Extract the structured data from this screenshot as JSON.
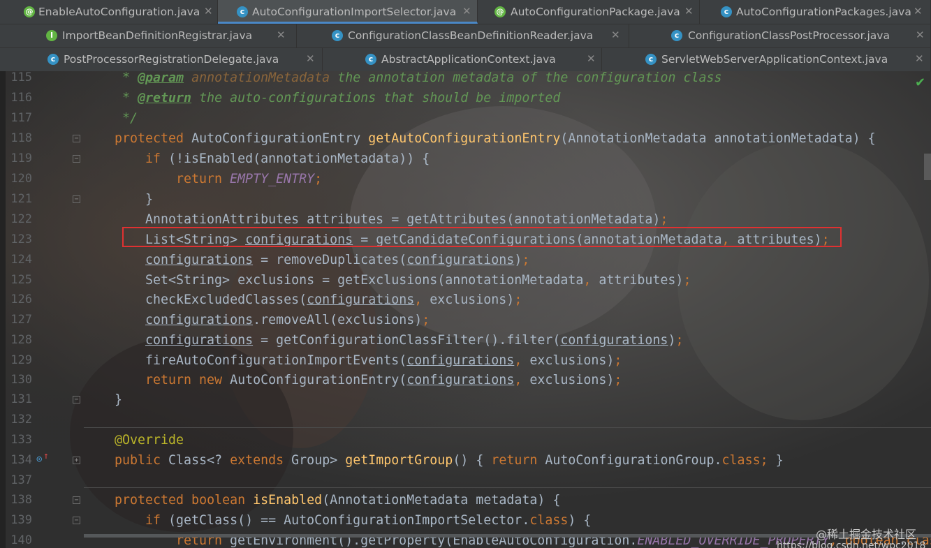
{
  "tabs": {
    "row1": [
      {
        "icon": "annotation-icon",
        "label": "EnableAutoConfiguration.java"
      },
      {
        "icon": "class-icon",
        "label": "AutoConfigurationImportSelector.java",
        "active": true
      },
      {
        "icon": "annotation-icon",
        "label": "AutoConfigurationPackage.java"
      },
      {
        "icon": "class-icon",
        "label": "AutoConfigurationPackages.java"
      }
    ],
    "row2": [
      {
        "icon": "interface-icon",
        "label": "ImportBeanDefinitionRegistrar.java"
      },
      {
        "icon": "class-icon",
        "label": "ConfigurationClassBeanDefinitionReader.java"
      },
      {
        "icon": "class-icon",
        "label": "ConfigurationClassPostProcessor.java"
      }
    ],
    "row3": [
      {
        "icon": "class-icon",
        "label": "PostProcessorRegistrationDelegate.java"
      },
      {
        "icon": "class-icon",
        "label": "AbstractApplicationContext.java"
      },
      {
        "icon": "class-icon",
        "label": "ServletWebServerApplicationContext.java"
      }
    ]
  },
  "editor": {
    "line_numbers": [
      "115",
      "116",
      "117",
      "118",
      "119",
      "120",
      "121",
      "122",
      "123",
      "124",
      "125",
      "126",
      "127",
      "128",
      "129",
      "130",
      "131",
      "132",
      "133",
      "134",
      "137",
      "138",
      "139",
      "140"
    ],
    "highlighted_line": "123",
    "status_icon": "inspection-ok-icon",
    "watermark": [
      "@稀土掘金技术社区",
      "https://blog.csdn.net/wpc2018"
    ]
  },
  "colors": {
    "background": "#2b2b2b",
    "keyword": "#cc7832",
    "method": "#ffc66d",
    "text": "#a9b7c6",
    "javadoc": "#629755",
    "constant": "#9876aa",
    "annotation": "#bbb529",
    "highlight_border": "#e03131",
    "active_tab_underline": "#4a88c7"
  }
}
